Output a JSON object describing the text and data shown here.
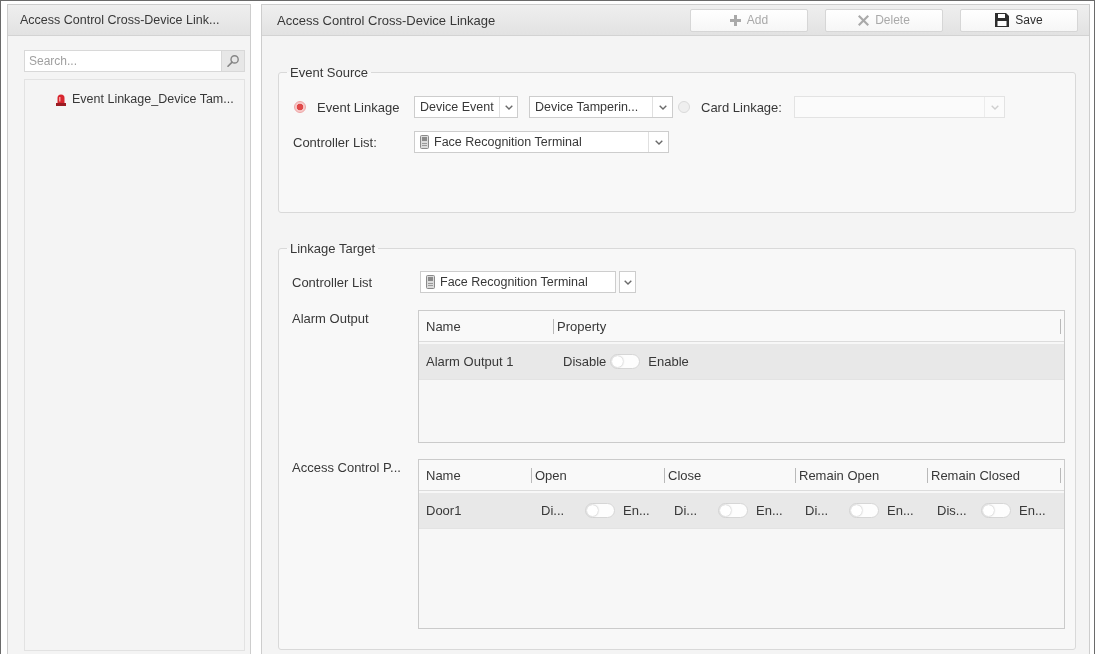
{
  "sidebar": {
    "title": "Access Control Cross-Device Link...",
    "search": {
      "placeholder": "Search..."
    },
    "items": [
      {
        "label": "Event Linkage_Device Tam...",
        "selected": false
      }
    ]
  },
  "main": {
    "title": "Access Control Cross-Device Linkage",
    "buttons": [
      {
        "kind": "add",
        "label": "Add",
        "disabled": true
      },
      {
        "kind": "delete",
        "label": "Delete",
        "disabled": true
      },
      {
        "kind": "save",
        "label": "Save",
        "disabled": false
      }
    ]
  },
  "event_source": {
    "title": "Event Source",
    "options": [
      {
        "label": "Event Linkage",
        "selected": true,
        "selects": [
          {
            "value": "Device Event",
            "disabled": false
          },
          {
            "value": "Device Tamperin...",
            "disabled": false
          }
        ]
      },
      {
        "label": "Card Linkage:",
        "selected": false,
        "selects": [
          {
            "disabled": true
          }
        ]
      }
    ],
    "controller_list": {
      "label": "Controller List:",
      "value": "Face Recognition Terminal"
    }
  },
  "linkage_target": {
    "title": "Linkage Target",
    "controller_list": {
      "label": "Controller List",
      "value": "Face Recognition Terminal"
    },
    "tables": [
      {
        "label": "Alarm Output",
        "columns": [
          "Name",
          "Property"
        ],
        "rows": [
          {
            "name": "Alarm Output 1",
            "selected": true,
            "switches": [
              {
                "off_label": "Disable",
                "on_label": "Enable",
                "on": false
              }
            ]
          }
        ]
      },
      {
        "label": "Access Control P...",
        "columns": [
          "Name",
          "Open",
          "Close",
          "Remain Open",
          "Remain Closed"
        ],
        "rows": [
          {
            "name": "Door1",
            "selected": true,
            "switches": [
              {
                "off_label": "Di...",
                "on_label": "En...",
                "on": false
              },
              {
                "off_label": "Di...",
                "on_label": "En...",
                "on": false
              },
              {
                "off_label": "Di...",
                "on_label": "En...",
                "on": false
              },
              {
                "off_label": "Dis...",
                "on_label": "En...",
                "on": false
              }
            ]
          }
        ]
      }
    ]
  }
}
